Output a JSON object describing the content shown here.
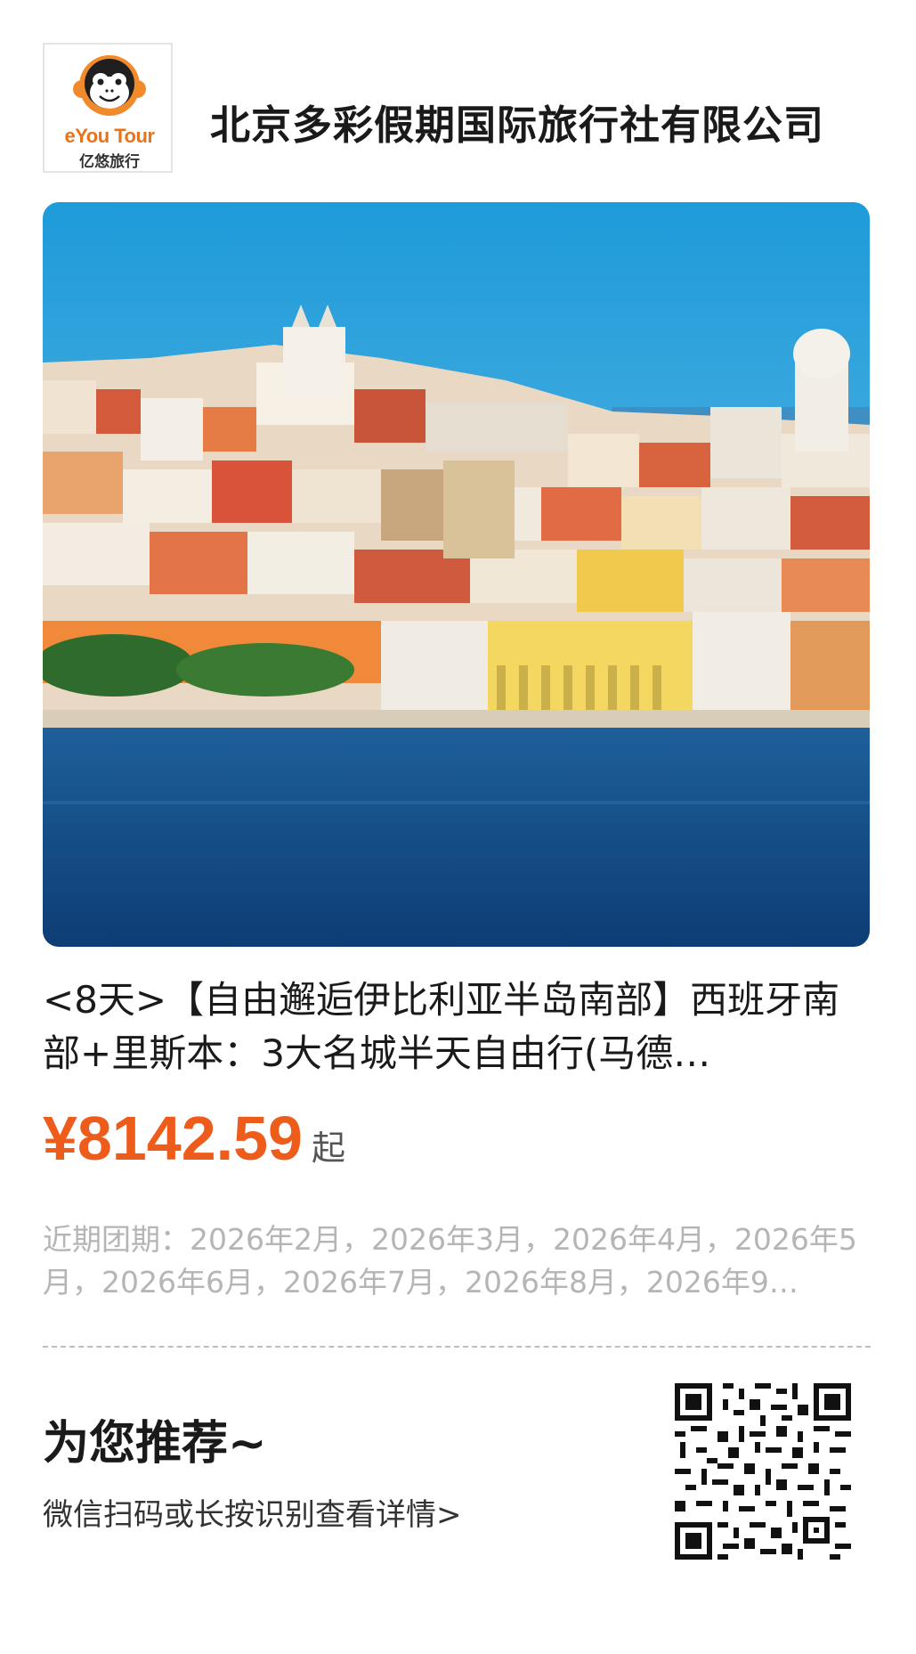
{
  "header": {
    "logo_text_en_1": "eYou",
    "logo_text_en_2": " Tour",
    "logo_text_cn": "亿悠旅行",
    "company_name": "北京多彩假期国际旅行社有限公司"
  },
  "product": {
    "title": "<8天>【自由邂逅伊比利亚半岛南部】西班牙南部+里斯本：3大名城半天自由行(马德…",
    "price": "¥8142.59",
    "price_suffix": "起",
    "dates": "近期团期：2026年2月，2026年3月，2026年4月，2026年5月，2026年6月，2026年7月，2026年8月，2026年9…"
  },
  "recommend": {
    "title": "为您推荐~",
    "subtitle": "微信扫码或长按识别查看详情>"
  },
  "colors": {
    "accent": "#ee5c1c",
    "logo_orange": "#e8731a",
    "muted": "#b5b5b5"
  }
}
